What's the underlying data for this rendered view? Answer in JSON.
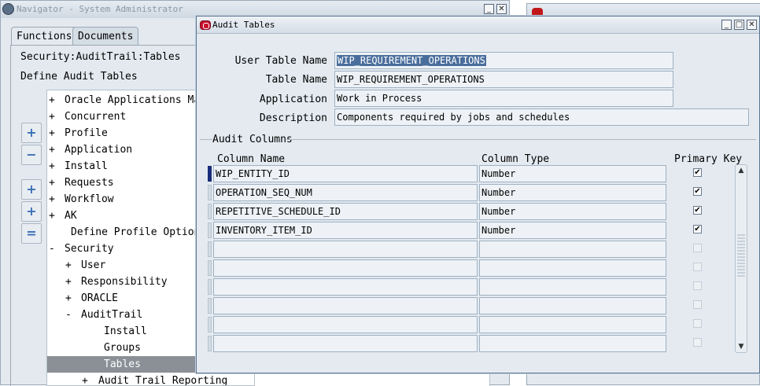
{
  "navigator": {
    "title": "Navigator - System Administrator",
    "tabs": [
      "Functions",
      "Documents"
    ],
    "breadcrumb": "Security:AuditTrail:Tables",
    "section_title": "Define Audit Tables",
    "tree": [
      {
        "prefix": "+",
        "label": "Oracle Applications Mana"
      },
      {
        "prefix": "+",
        "label": "Concurrent"
      },
      {
        "prefix": "+",
        "label": "Profile"
      },
      {
        "prefix": "+",
        "label": "Application"
      },
      {
        "prefix": "+",
        "label": "Install"
      },
      {
        "prefix": "+",
        "label": "Requests"
      },
      {
        "prefix": "+",
        "label": "Workflow"
      },
      {
        "prefix": "+",
        "label": "AK"
      },
      {
        "prefix": "",
        "label": "Define Profile Options"
      },
      {
        "prefix": "-",
        "label": "Security"
      },
      {
        "prefix": "+",
        "label": "User"
      },
      {
        "prefix": "+",
        "label": "Responsibility"
      },
      {
        "prefix": "+",
        "label": "ORACLE"
      },
      {
        "prefix": "-",
        "label": "AuditTrail"
      },
      {
        "prefix": "",
        "label": "Install"
      },
      {
        "prefix": "",
        "label": "Groups"
      },
      {
        "prefix": "",
        "label": "Tables"
      },
      {
        "prefix": "+",
        "label": "Audit Trail Reporting"
      }
    ],
    "side_buttons": [
      "expand-icon",
      "collapse-icon",
      "expand-branch-icon",
      "expand-all-icon",
      "collapse-all-icon"
    ]
  },
  "dialog": {
    "title": "Audit Tables",
    "labels": {
      "user_table_name": "User Table Name",
      "table_name": "Table Name",
      "application": "Application",
      "description": "Description"
    },
    "values": {
      "user_table_name": "WIP_REQUIREMENT_OPERATIONS",
      "table_name": "WIP_REQUIREMENT_OPERATIONS",
      "application": "Work in Process",
      "description": "Components required by jobs and schedules"
    },
    "group_title": "Audit Columns",
    "columns": [
      "Column Name",
      "Column Type",
      "Primary Key"
    ],
    "rows": [
      {
        "name": "WIP_ENTITY_ID",
        "type": "Number",
        "pk": "✔"
      },
      {
        "name": "OPERATION_SEQ_NUM",
        "type": "Number",
        "pk": "✔"
      },
      {
        "name": "REPETITIVE_SCHEDULE_ID",
        "type": "Number",
        "pk": "✔"
      },
      {
        "name": "INVENTORY_ITEM_ID",
        "type": "Number",
        "pk": "✔"
      },
      {
        "name": "",
        "type": "",
        "pk": ""
      },
      {
        "name": "",
        "type": "",
        "pk": ""
      },
      {
        "name": "",
        "type": "",
        "pk": ""
      },
      {
        "name": "",
        "type": "",
        "pk": ""
      },
      {
        "name": "",
        "type": "",
        "pk": ""
      },
      {
        "name": "",
        "type": "",
        "pk": ""
      }
    ]
  }
}
